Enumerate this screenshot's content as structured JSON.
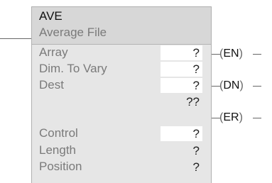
{
  "instruction": {
    "name": "AVE",
    "description": "Average File"
  },
  "parameters": [
    {
      "label": "Array",
      "value": "?"
    },
    {
      "label": "Dim. To Vary",
      "value": "?"
    },
    {
      "label": "Dest",
      "value": "?"
    },
    {
      "label": "",
      "value": "??"
    },
    {
      "label": "Control",
      "value": "?"
    },
    {
      "label": "Length",
      "value": "?"
    },
    {
      "label": "Position",
      "value": "?"
    }
  ],
  "outputs": [
    {
      "label": "EN"
    },
    {
      "label": "DN"
    },
    {
      "label": "ER"
    }
  ]
}
